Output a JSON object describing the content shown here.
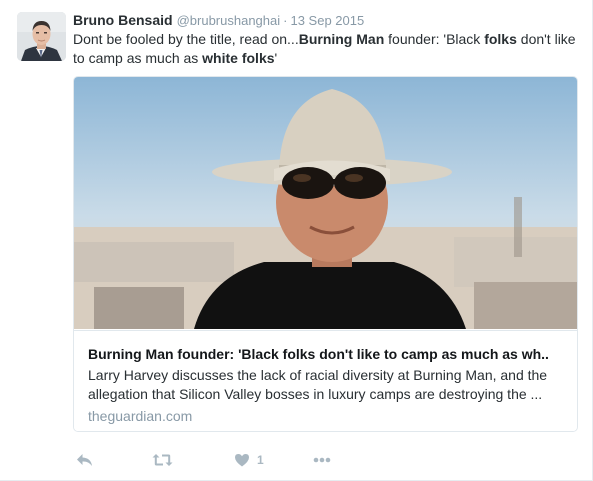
{
  "tweet": {
    "fullname": "Bruno Bensaid",
    "username": "@brubrushanghai",
    "separator": "·",
    "timestamp": "13 Sep 2015",
    "text_parts": {
      "p1": "Dont be fooled by the title, read on...",
      "p2": "Burning Man",
      "p3": " founder: 'Black ",
      "p4": "folks",
      "p5": " don't like to camp as much as ",
      "p6": "white folks",
      "p7": "'"
    }
  },
  "card": {
    "title": "Burning Man founder: 'Black folks don't like to camp as much as wh..",
    "description": "Larry Harvey discusses the lack of racial diversity at Burning Man, and the allegation that Silicon Valley bosses in luxury camps are destroying the ...",
    "domain": "theguardian.com"
  },
  "actions": {
    "like_count": "1"
  },
  "icons": {
    "reply": "reply-icon",
    "retweet": "retweet-icon",
    "like": "heart-icon",
    "more": "more-icon"
  },
  "colors": {
    "text": "#292f33",
    "muted": "#8899a6",
    "action_icon": "#aab8c2",
    "border": "#e1e8ed"
  }
}
